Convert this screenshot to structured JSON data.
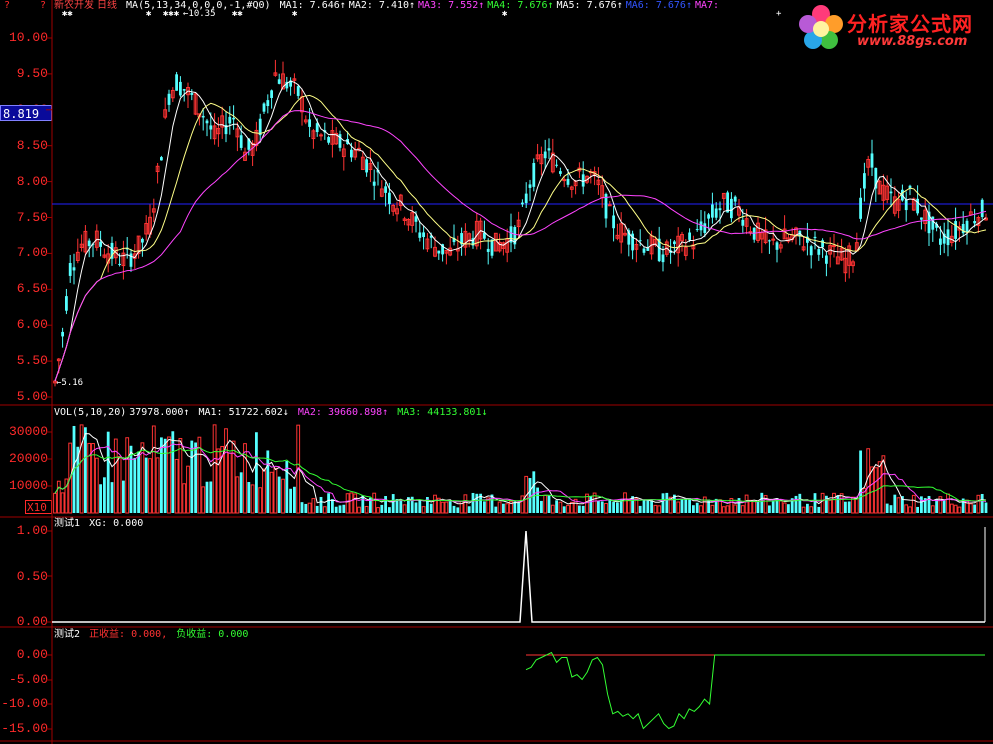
{
  "header": {
    "qmarks": [
      "?",
      "?"
    ],
    "stock_name": "新农开发",
    "period": "日线",
    "ma_params": "MA(5,13,34,0,0,0,-1,#Q0)",
    "ma_values": [
      {
        "label": "MA1: 7.646↑",
        "color": "#ffffff"
      },
      {
        "label": "MA2: 7.410↑",
        "color": "#ffffff"
      },
      {
        "label": "MA3: 7.552↑",
        "color": "#ff44ff"
      },
      {
        "label": "MA4: 7.676↑",
        "color": "#33ff33"
      },
      {
        "label": "MA5: 7.676↑",
        "color": "#ffffff"
      },
      {
        "label": "MA6: 7.676↑",
        "color": "#3355ff"
      },
      {
        "label": "MA7:",
        "color": "#ff44ff"
      }
    ],
    "high_marker": "←10.35",
    "low_marker": "←5.16",
    "current_price": "8.819"
  },
  "price_axis": [
    "10.00",
    "9.50",
    "9.00",
    "8.50",
    "8.00",
    "7.50",
    "7.00",
    "6.50",
    "6.00",
    "5.50",
    "5.00"
  ],
  "volume": {
    "header": {
      "params": "VOL(5,10,20)",
      "value": "37978.000↑",
      "ma1": "MA1: 51722.602↓",
      "ma2": "MA2: 39660.898↑",
      "ma3": "MA3: 44133.801↓"
    },
    "axis": [
      "30000",
      "20000",
      "10000"
    ],
    "unit_badge": "X10"
  },
  "test1": {
    "header": {
      "name": "测试1",
      "xg": "XG: 0.000"
    },
    "axis": [
      "1.00",
      "0.50",
      "0.00"
    ]
  },
  "test2": {
    "header": {
      "name": "测试2",
      "pos": "正收益: 0.000,",
      "neg": "负收益: 0.000"
    },
    "axis": [
      "0.00",
      "-5.00",
      "-10.00",
      "-15.00"
    ],
    "series_points": [
      [
        -3,
        0
      ],
      [
        -2.5,
        1
      ],
      [
        -1,
        2
      ],
      [
        -0.5,
        3
      ],
      [
        0.5,
        5
      ],
      [
        -1.5,
        6
      ],
      [
        -0.5,
        7
      ],
      [
        -0.5,
        8
      ],
      [
        -4.5,
        9
      ],
      [
        -4,
        10
      ],
      [
        -5,
        11
      ],
      [
        -3.5,
        12
      ],
      [
        -1,
        13
      ],
      [
        -0.5,
        14
      ],
      [
        -2,
        15
      ],
      [
        -8,
        16
      ],
      [
        -12,
        17
      ],
      [
        -11.5,
        18
      ],
      [
        -12.5,
        19
      ],
      [
        -12,
        20
      ],
      [
        -13,
        21
      ],
      [
        -12,
        22
      ],
      [
        -15,
        23
      ],
      [
        -14,
        24
      ],
      [
        -13,
        25
      ],
      [
        -12,
        26
      ],
      [
        -14,
        27
      ],
      [
        -15,
        28
      ],
      [
        -14.5,
        29
      ],
      [
        -12,
        30
      ],
      [
        -13,
        31
      ],
      [
        -11,
        32
      ],
      [
        -11.5,
        33
      ],
      [
        -10.5,
        34
      ],
      [
        -9,
        35
      ],
      [
        -10,
        36
      ],
      [
        0,
        37
      ]
    ]
  },
  "logo": {
    "name": "分析家公式网",
    "url": "www.88gs.com"
  },
  "colors": {
    "up": "#ff3333",
    "down": "#55ffff",
    "ma5": "#ffffff",
    "ma13": "#ffff88",
    "ma34": "#ff44ff",
    "refline": "#2222ff",
    "border": "#a00000"
  }
}
